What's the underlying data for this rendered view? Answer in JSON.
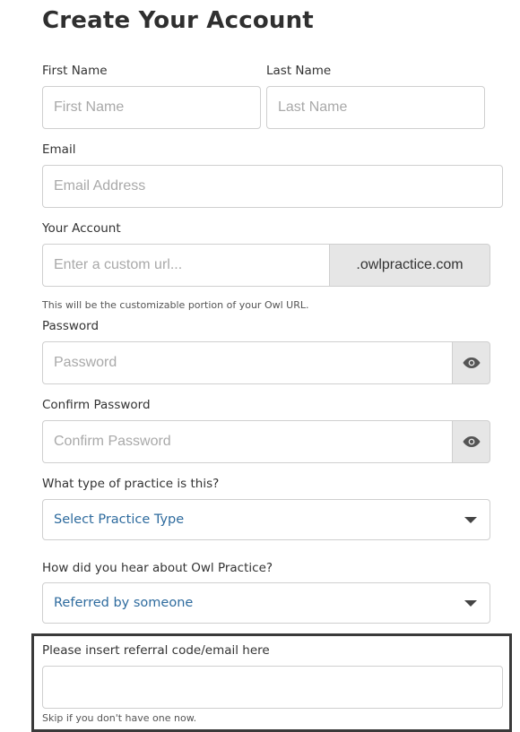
{
  "page": {
    "title": "Create Your Account"
  },
  "first_name": {
    "label": "First Name",
    "placeholder": "First Name"
  },
  "last_name": {
    "label": "Last Name",
    "placeholder": "Last Name"
  },
  "email": {
    "label": "Email",
    "placeholder": "Email Address"
  },
  "account": {
    "label": "Your Account",
    "placeholder": "Enter a custom url...",
    "suffix": ".owlpractice.com",
    "help": "This will be the customizable portion of your Owl URL."
  },
  "password": {
    "label": "Password",
    "placeholder": "Password",
    "toggle_icon": "eye-icon"
  },
  "confirm_password": {
    "label": "Confirm Password",
    "placeholder": "Confirm Password",
    "toggle_icon": "eye-icon"
  },
  "practice_type": {
    "label": "What type of practice is this?",
    "selected": "Select Practice Type"
  },
  "heard_about": {
    "label": "How did you hear about Owl Practice?",
    "selected": "Referred by someone"
  },
  "referral": {
    "label": "Please insert referral code/email here",
    "value": "",
    "help": "Skip if you don't have one now."
  },
  "colors": {
    "select_text": "#2e6b9e",
    "highlight_border": "#3a3a3a",
    "addon_bg": "#e6e6e6"
  }
}
